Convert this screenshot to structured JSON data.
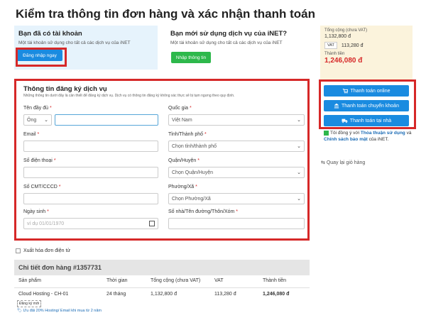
{
  "page": {
    "title": "Kiểm tra thông tin đơn hàng và xác nhận thanh toán"
  },
  "login_card": {
    "title": "Bạn đã có tài khoản",
    "desc": "Một tài khoản sử dụng cho tất cả các dịch vụ của iNET",
    "button": "Đăng nhập ngay"
  },
  "new_card": {
    "title": "Bạn mới sử dụng dịch vụ của iNET?",
    "desc": "Một tài khoản sử dụng cho tất cả các dịch vụ của iNET",
    "button": "Nhập thông tin"
  },
  "summary": {
    "subtotal_label": "Tổng cộng (chưa VAT)",
    "subtotal": "1,132,800 đ",
    "vat_label": "VAT",
    "vat": "113,280 đ",
    "total_label": "Thành tiền",
    "total": "1,246,080 đ"
  },
  "payment": {
    "online": "Thanh toán online",
    "transfer": "Thanh toán chuyển khoản",
    "home": "Thanh toán tại nhà",
    "agree_prefix": "Tôi đồng ý với ",
    "terms": "Thỏa thuận sử dụng",
    "and": " và ",
    "privacy": "Chính sách bảo mật",
    "agree_suffix": " của iNET.",
    "back": "Quay lại giỏ hàng"
  },
  "form": {
    "title": "Thông tin đăng ký dịch vụ",
    "desc": "Những thông tin dưới đây là cần thiết để đăng ký dịch vụ. Dịch vụ có thông tin đăng ký không xác thực sẽ bị tạm ngưng theo quy định.",
    "fullname_label": "Tên đầy đủ",
    "salutation": "Ông",
    "country_label": "Quốc gia",
    "country": "Việt Nam",
    "email_label": "Email",
    "province_label": "Tỉnh/Thành phố",
    "province_ph": "Chọn tỉnh/thành phố",
    "phone_label": "Số điện thoại",
    "district_label": "Quận/Huyện",
    "district_ph": "Chọn Quận/Huyện",
    "id_label": "Số CMT/CCCD",
    "ward_label": "Phường/Xã",
    "ward_ph": "Chọn Phường/Xã",
    "dob_label": "Ngày sinh",
    "dob_ph": "ví dụ 01/01/1970",
    "address_label": "Số nhà/Tên đường/Thôn/Xóm",
    "required_mark": "*"
  },
  "invoice": {
    "label": "Xuất hóa đơn điện tử"
  },
  "order": {
    "title": "Chi tiết đơn hàng #1357731",
    "columns": [
      "Sản phẩm",
      "Thời gian",
      "Tổng cộng (chưa VAT)",
      "VAT",
      "Thành tiền"
    ],
    "row": {
      "product": "Cloud Hosting - CH-01",
      "tag": "Đăng ký mới",
      "promo": "Ưu đãi 20% Hosting/ Email khi mua từ 2 năm",
      "period": "24 tháng",
      "subtotal": "1,132,800 đ",
      "vat": "113,280 đ",
      "total": "1,246,080 đ"
    }
  },
  "icons": {
    "cart": "cart-icon",
    "bank": "bank-icon",
    "truck": "truck-icon",
    "calendar": "calendar-icon",
    "chevron": "chevron-down-icon",
    "tag": "tag-icon",
    "back": "back-icon"
  },
  "colors": {
    "primary": "#1a8be0",
    "green": "#2db84b",
    "red": "#d62828",
    "summary_bg": "#fbf3dc",
    "login_bg": "#e6f3fc"
  }
}
